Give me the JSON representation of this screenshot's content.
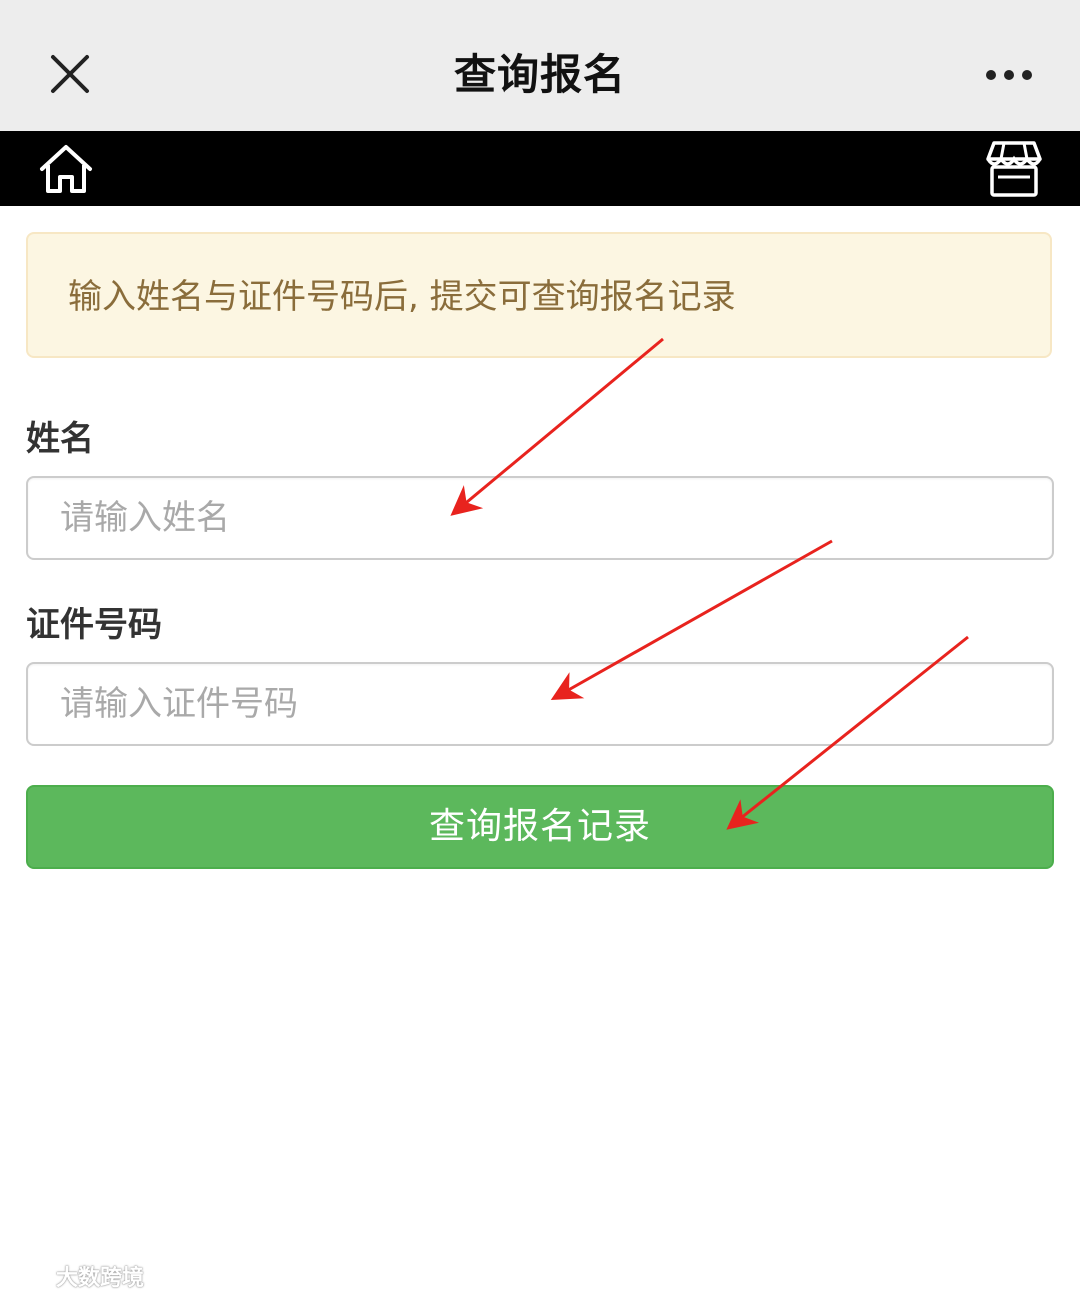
{
  "header": {
    "title": "查询报名",
    "close_icon": "close-icon",
    "more_icon": "more-dots-icon"
  },
  "navbar": {
    "home_icon": "home-icon",
    "store_icon": "store-icon"
  },
  "notice": {
    "text": "输入姓名与证件号码后, 提交可查询报名记录"
  },
  "form": {
    "name_label": "姓名",
    "name_placeholder": "请输入姓名",
    "name_value": "",
    "id_label": "证件号码",
    "id_placeholder": "请输入证件号码",
    "id_value": "",
    "submit_label": "查询报名记录"
  },
  "watermark": {
    "text": "大数跨境"
  },
  "colors": {
    "header_bg": "#ededed",
    "navbar_bg": "#000000",
    "notice_bg": "#fcf6e2",
    "notice_text": "#8a6d3b",
    "submit_bg": "#5cb85c",
    "arrow": "#e8231e"
  }
}
